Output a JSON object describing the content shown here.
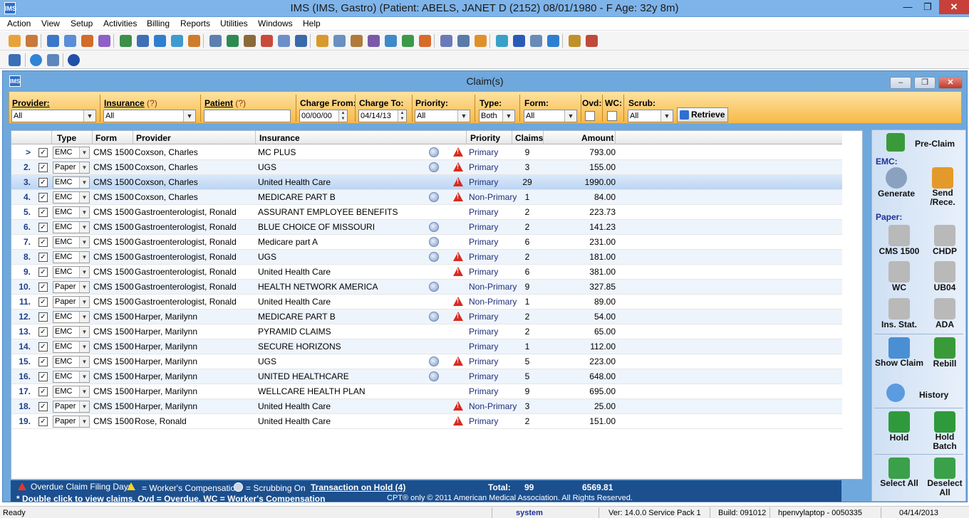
{
  "app": {
    "title": "IMS (IMS, Gastro)      (Patient: ABELS, JANET  D (2152) 08/01/1980 - F Age: 32y 8m)",
    "logo": "IMS"
  },
  "menu": [
    "Action",
    "View",
    "Setup",
    "Activities",
    "Billing",
    "Reports",
    "Utilities",
    "Windows",
    "Help"
  ],
  "window": {
    "title": "Claim(s)"
  },
  "filters": {
    "provider_label": "Provider:",
    "provider_value": "All",
    "insurance_label": "Insurance",
    "insurance_hint": "(?)",
    "insurance_value": "All",
    "patient_label": "Patient",
    "patient_hint": "(?)",
    "patient_value": "",
    "charge_from_label": "Charge From:",
    "charge_from_value": "00/00/00",
    "charge_to_label": "Charge To:",
    "charge_to_value": "04/14/13",
    "priority_label": "Priority:",
    "priority_value": "All",
    "type_label": "Type:",
    "type_value": "Both",
    "form_label": "Form:",
    "form_value": "All",
    "ovd_label": "Ovd:",
    "wc_label": "WC:",
    "scrub_label": "Scrub:",
    "scrub_value": "All",
    "retrieve_label": "Retrieve"
  },
  "grid": {
    "headers": {
      "type": "Type",
      "form": "Form",
      "provider": "Provider",
      "insurance": "Insurance",
      "priority": "Priority",
      "claims": "Claims",
      "amount": "Amount"
    },
    "rows": [
      {
        "num": ">",
        "type": "EMC",
        "form": "CMS 1500",
        "provider": "Coxson, Charles",
        "insurance": "MC PLUS",
        "scrub": true,
        "warn": true,
        "priority": "Primary",
        "claims": "9",
        "amount": "793.00"
      },
      {
        "num": "2.",
        "type": "Paper",
        "form": "CMS 1500",
        "provider": "Coxson, Charles",
        "insurance": "UGS",
        "scrub": true,
        "warn": true,
        "priority": "Primary",
        "claims": "3",
        "amount": "155.00"
      },
      {
        "num": "3.",
        "type": "EMC",
        "form": "CMS 1500",
        "provider": "Coxson, Charles",
        "insurance": "United Health Care",
        "scrub": false,
        "warn": true,
        "priority": "Primary",
        "claims": "29",
        "amount": "1990.00"
      },
      {
        "num": "4.",
        "type": "EMC",
        "form": "CMS 1500",
        "provider": "Coxson, Charles",
        "insurance": "MEDICARE PART B",
        "scrub": true,
        "warn": true,
        "priority": "Non-Primary",
        "claims": "1",
        "amount": "84.00"
      },
      {
        "num": "5.",
        "type": "EMC",
        "form": "CMS 1500",
        "provider": "Gastroenterologist, Ronald",
        "insurance": "ASSURANT EMPLOYEE BENEFITS",
        "scrub": false,
        "warn": false,
        "priority": "Primary",
        "claims": "2",
        "amount": "223.73"
      },
      {
        "num": "6.",
        "type": "EMC",
        "form": "CMS 1500",
        "provider": "Gastroenterologist, Ronald",
        "insurance": "BLUE CHOICE OF MISSOURI",
        "scrub": true,
        "warn": false,
        "priority": "Primary",
        "claims": "2",
        "amount": "141.23"
      },
      {
        "num": "7.",
        "type": "EMC",
        "form": "CMS 1500",
        "provider": "Gastroenterologist, Ronald",
        "insurance": "Medicare part A",
        "scrub": true,
        "warn": false,
        "priority": "Primary",
        "claims": "6",
        "amount": "231.00"
      },
      {
        "num": "8.",
        "type": "EMC",
        "form": "CMS 1500",
        "provider": "Gastroenterologist, Ronald",
        "insurance": "UGS",
        "scrub": true,
        "warn": true,
        "priority": "Primary",
        "claims": "2",
        "amount": "181.00"
      },
      {
        "num": "9.",
        "type": "EMC",
        "form": "CMS 1500",
        "provider": "Gastroenterologist, Ronald",
        "insurance": "United Health Care",
        "scrub": false,
        "warn": true,
        "priority": "Primary",
        "claims": "6",
        "amount": "381.00"
      },
      {
        "num": "10.",
        "type": "Paper",
        "form": "CMS 1500",
        "provider": "Gastroenterologist, Ronald",
        "insurance": "HEALTH NETWORK AMERICA",
        "scrub": true,
        "warn": false,
        "priority": "Non-Primary",
        "claims": "9",
        "amount": "327.85"
      },
      {
        "num": "11.",
        "type": "Paper",
        "form": "CMS 1500",
        "provider": "Gastroenterologist, Ronald",
        "insurance": "United Health Care",
        "scrub": false,
        "warn": true,
        "priority": "Non-Primary",
        "claims": "1",
        "amount": "89.00"
      },
      {
        "num": "12.",
        "type": "EMC",
        "form": "CMS 1500",
        "provider": "Harper, Marilynn",
        "insurance": "MEDICARE PART B",
        "scrub": true,
        "warn": true,
        "priority": "Primary",
        "claims": "2",
        "amount": "54.00"
      },
      {
        "num": "13.",
        "type": "EMC",
        "form": "CMS 1500",
        "provider": "Harper, Marilynn",
        "insurance": "PYRAMID CLAIMS",
        "scrub": false,
        "warn": false,
        "priority": "Primary",
        "claims": "2",
        "amount": "65.00"
      },
      {
        "num": "14.",
        "type": "EMC",
        "form": "CMS 1500",
        "provider": "Harper, Marilynn",
        "insurance": "SECURE HORIZONS",
        "scrub": false,
        "warn": false,
        "priority": "Primary",
        "claims": "1",
        "amount": "112.00"
      },
      {
        "num": "15.",
        "type": "EMC",
        "form": "CMS 1500",
        "provider": "Harper, Marilynn",
        "insurance": "UGS",
        "scrub": true,
        "warn": true,
        "priority": "Primary",
        "claims": "5",
        "amount": "223.00"
      },
      {
        "num": "16.",
        "type": "EMC",
        "form": "CMS 1500",
        "provider": "Harper, Marilynn",
        "insurance": "UNITED HEALTHCARE",
        "scrub": true,
        "warn": false,
        "priority": "Primary",
        "claims": "5",
        "amount": "648.00"
      },
      {
        "num": "17.",
        "type": "EMC",
        "form": "CMS 1500",
        "provider": "Harper, Marilynn",
        "insurance": "WELLCARE HEALTH PLAN",
        "scrub": false,
        "warn": false,
        "priority": "Primary",
        "claims": "9",
        "amount": "695.00"
      },
      {
        "num": "18.",
        "type": "Paper",
        "form": "CMS 1500",
        "provider": "Harper, Marilynn",
        "insurance": "United Health Care",
        "scrub": false,
        "warn": true,
        "priority": "Non-Primary",
        "claims": "3",
        "amount": "25.00"
      },
      {
        "num": "19.",
        "type": "Paper",
        "form": "CMS 1500",
        "provider": "Rose, Ronald",
        "insurance": "United Health Care",
        "scrub": false,
        "warn": true,
        "priority": "Primary",
        "claims": "2",
        "amount": "151.00"
      }
    ]
  },
  "legend": {
    "overdue": "Overdue Claim Filing Days.",
    "wc": "= Worker's Compensation.",
    "scrub": "= Scrubbing On",
    "hold_link": "Transaction on Hold (4)",
    "total_label": "Total:",
    "total_claims": "99",
    "total_amount": "6569.81",
    "hint": "* Double click to view claims. Ovd = Overdue, WC = Worker's Compensation",
    "cpt": "CPT® only © 2011 American Medical Association.  All Rights Reserved."
  },
  "panel": {
    "preclaim": "Pre-Claim",
    "emc_label": "EMC:",
    "generate": "Generate",
    "send": "Send /Rece.",
    "paper_label": "Paper:",
    "cms1500": "CMS 1500",
    "chdp": "CHDP",
    "wc": "WC",
    "ub04": "UB04",
    "insstat": "Ins. Stat.",
    "ada": "ADA",
    "showclaim": "Show Claim",
    "rebill": "Rebill",
    "history": "History",
    "hold": "Hold",
    "holdbatch": "Hold Batch",
    "selectall": "Select All",
    "deselectall": "Deselect All"
  },
  "status": {
    "ready": "Ready",
    "user": "system",
    "version": "Ver: 14.0.0 Service Pack 1",
    "build": "Build: 091012",
    "machine": "hpenvylaptop - 0050335",
    "date": "04/14/2013"
  },
  "colors": {
    "accent": "#1b4f8e",
    "filterbar": "#f7b948",
    "titlebar": "#7eb4ea"
  }
}
